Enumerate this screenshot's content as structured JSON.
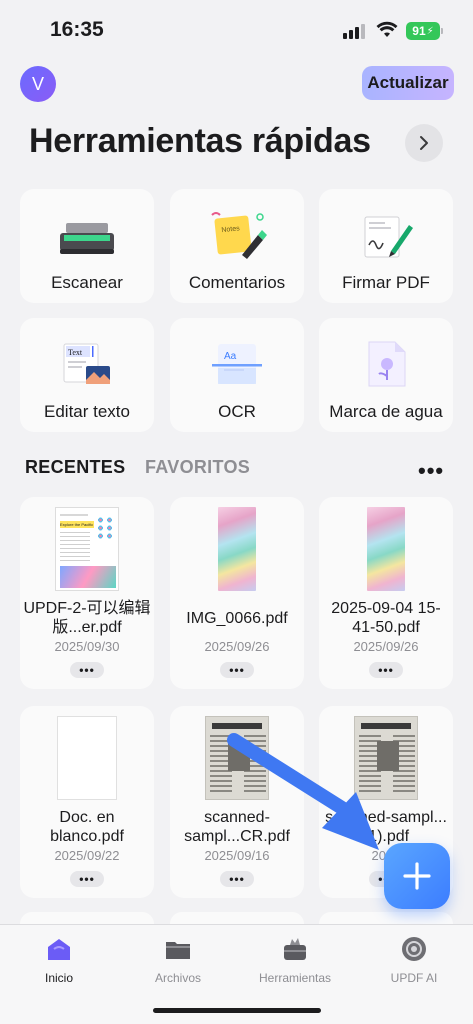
{
  "status_bar": {
    "time": "16:35",
    "battery": "91"
  },
  "header": {
    "avatar_letter": "V",
    "update_label": "Actualizar"
  },
  "quick_tools": {
    "title": "Herramientas rápidas",
    "items": [
      {
        "label": "Escanear",
        "icon": "scanner-icon"
      },
      {
        "label": "Comentarios",
        "icon": "sticky-note-icon"
      },
      {
        "label": "Firmar PDF",
        "icon": "signature-icon"
      },
      {
        "label": "Editar texto",
        "icon": "edit-text-icon"
      },
      {
        "label": "OCR",
        "icon": "ocr-icon"
      },
      {
        "label": "Marca de agua",
        "icon": "watermark-icon"
      }
    ]
  },
  "tabs": {
    "recent": "RECENTES",
    "favorites": "FAVORITOS",
    "more": "•••"
  },
  "files": [
    {
      "name": "UPDF-2-可以编辑版...er.pdf",
      "date": "2025/09/30",
      "more": "•••"
    },
    {
      "name": "IMG_0066.pdf",
      "date": "2025/09/26",
      "more": "•••"
    },
    {
      "name": "2025-09-04 15-41-50.pdf",
      "date": "2025/09/26",
      "more": "•••"
    },
    {
      "name": "Doc. en blanco.pdf",
      "date": "2025/09/22",
      "more": "•••"
    },
    {
      "name": "scanned-sampl...CR.pdf",
      "date": "2025/09/16",
      "more": "•••"
    },
    {
      "name": "scanned-sampl...(1).pdf",
      "date": "2025",
      "more": "•••"
    }
  ],
  "thumb_texts": {
    "explore": "Explore the Pacific",
    "news": "Amazon wildlife",
    "text_tag": "Text",
    "aa": "Aa",
    "notes": "Notes"
  },
  "bottom_nav": [
    {
      "label": "Inicio",
      "icon": "home-icon"
    },
    {
      "label": "Archivos",
      "icon": "folder-icon"
    },
    {
      "label": "Herramientas",
      "icon": "toolbox-icon"
    },
    {
      "label": "UPDF AI",
      "icon": "ai-icon"
    }
  ],
  "colors": {
    "accent": "#3c7dff",
    "battery": "#34c759"
  }
}
